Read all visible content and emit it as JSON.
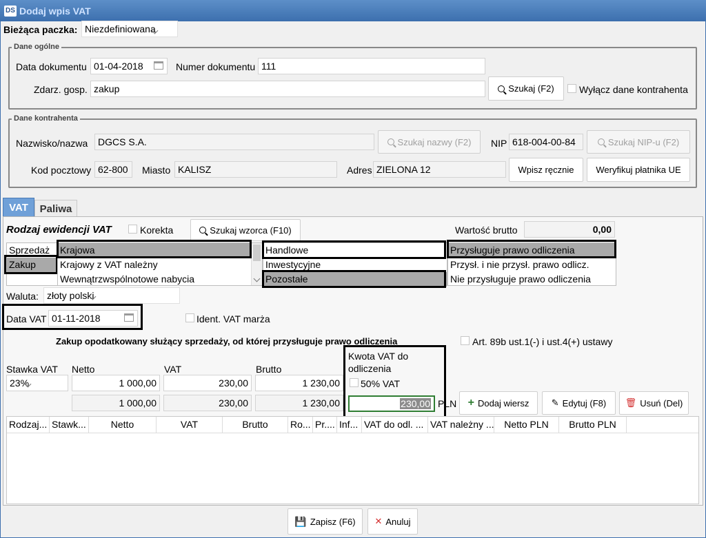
{
  "window": {
    "logo": "DS",
    "title": "Dodaj wpis VAT"
  },
  "batch": {
    "label": "Bieżąca paczka:",
    "value": "Niezdefiniowana"
  },
  "general": {
    "legend": "Dane ogólne",
    "doc_date_label": "Data dokumentu",
    "doc_date": "01-04-2018",
    "doc_number_label": "Numer dokumentu",
    "doc_number": "111",
    "event_label": "Zdarz. gosp.",
    "event_value": "zakup",
    "search_button": "Szukaj (F2)",
    "disable_contractor_label": "Wyłącz dane kontrahenta"
  },
  "contractor": {
    "legend": "Dane kontrahenta",
    "name_label": "Nazwisko/nazwa",
    "name": "DGCS S.A.",
    "search_name_button": "Szukaj nazwy (F2)",
    "nip_label": "NIP",
    "nip": "618-004-00-84",
    "search_nip_button": "Szukaj NIP-u (F2)",
    "postal_label": "Kod pocztowy",
    "postal": "62-800",
    "city_label": "Miasto",
    "city": "KALISZ",
    "address_label": "Adres",
    "address": "ZIELONA 12",
    "manual_button": "Wpisz ręcznie",
    "verify_button": "Weryfikuj płatnika UE"
  },
  "tabs": [
    "VAT",
    "Paliwa"
  ],
  "vat": {
    "register_type_label": "Rodzaj ewidencji VAT",
    "correction_label": "Korekta",
    "search_template_button": "Szukaj wzorca (F10)",
    "gross_value_label": "Wartość brutto",
    "gross_value": "0,00",
    "register_list": [
      "Sprzedaż",
      "Zakup"
    ],
    "scope_list": [
      "Krajowa",
      "Krajowy z VAT należny",
      "Wewnątrzwspólnotowe nabycia"
    ],
    "kind_list": [
      "Handlowe",
      "Inwestycyjne",
      "Pozostałe"
    ],
    "deduction_list": [
      "Przysługuje prawo odliczenia",
      "Przysł. i nie przysł. prawo odlicz.",
      "Nie przysługuje prawo odliczenia"
    ],
    "currency_label": "Waluta:",
    "currency": "złoty polski",
    "vat_date_label": "Data VAT",
    "vat_date": "01-11-2018",
    "margin_label": "Ident. VAT marża",
    "description": "Zakup opodatkowany służący sprzedaży, od której przysługuje prawo odliczenia",
    "art_label": "Art. 89b ust.1(-) i ust.4(+) ustawy",
    "rate_header": "Stawka VAT",
    "net_header": "Netto",
    "vat_header": "VAT",
    "gross_header": "Brutto",
    "deduct_header": "Kwota VAT do odliczenia",
    "rate": "23%",
    "net": "1 000,00",
    "vat_amount": "230,00",
    "gross": "1 230,00",
    "half_vat_label": "50% VAT",
    "net_pln": "1 000,00",
    "vat_pln": "230,00",
    "gross_pln": "1 230,00",
    "deduct_pln": "230,00",
    "currency_code": "PLN",
    "add_row_button": "Dodaj wiersz",
    "edit_button": "Edytuj (F8)",
    "delete_button": "Usuń (Del)"
  },
  "grid": {
    "columns": [
      "Rodzaj...",
      "Stawk...",
      "Netto",
      "VAT",
      "Brutto",
      "Ro...",
      "Pr....",
      "Inf...",
      "VAT do odl. ...",
      "VAT należny ...",
      "Netto PLN",
      "Brutto PLN"
    ]
  },
  "footer": {
    "save_button": "Zapisz (F6)",
    "cancel_button": "Anuluj"
  },
  "colors": {
    "titlebar": "#3c6fae",
    "selected_item": "#a9a9a9",
    "active_tab": "#6fa0d8",
    "focus_border": "#2e7d32",
    "delete_icon": "#d32f2f",
    "add_icon": "#2e7d32"
  }
}
